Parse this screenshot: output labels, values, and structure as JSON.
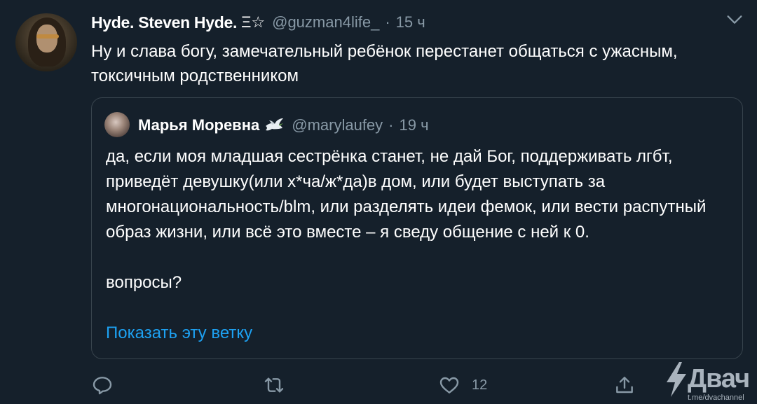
{
  "tweet": {
    "display_name": "Hyde. Steven Hyde.",
    "name_extra": "Ξ☆",
    "handle": "@guzman4life_",
    "separator": "·",
    "time": "15 ч",
    "text": "Ну и слава богу, замечательный ребёнок перестанет общаться с ужасным, токсичным родственником"
  },
  "quote": {
    "display_name": "Марья Моревна",
    "emoji": "dove-icon",
    "handle": "@marylaufey",
    "separator": "·",
    "time": "19 ч",
    "text": "да, если моя младшая сестрёнка станет, не дай Бог, поддерживать лгбт, приведёт девушку(или х*ча/ж*да)в дом, или будет выступать за многонациональность/blm, или разделять идеи фемок, или вести распутный образ жизни, или всё это вместе – я сведу общение с ней к 0.\n\nвопросы?",
    "show_thread_label": "Показать эту ветку"
  },
  "actions": {
    "reply_icon": "reply-icon",
    "retweet_icon": "retweet-icon",
    "like_icon": "heart-icon",
    "like_count": "12",
    "share_icon": "share-icon"
  },
  "watermark": {
    "logo_icon": "lightning-icon",
    "text": "Двач",
    "url": "t.me/dvachannel"
  },
  "colors": {
    "background": "#15202b",
    "border": "#38444d",
    "muted": "#8899a6",
    "link": "#1da1f2",
    "text": "#ffffff"
  }
}
